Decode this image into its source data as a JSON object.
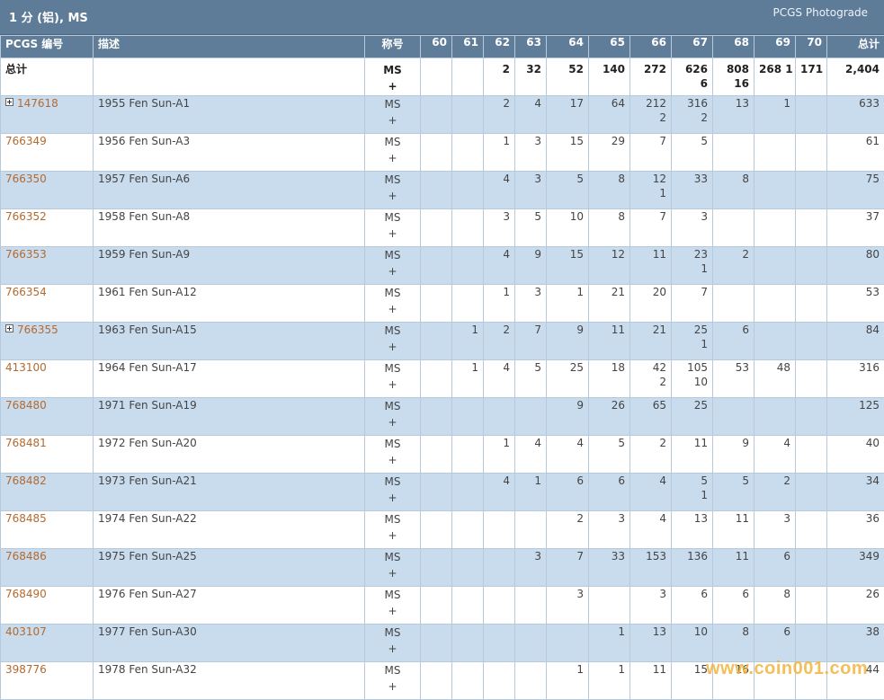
{
  "title": "1 分 (铝), MS",
  "brand": "PCGS Photograde",
  "headers": [
    "PCGS 编号",
    "描述",
    "称号",
    "60",
    "61",
    "62",
    "63",
    "64",
    "65",
    "66",
    "67",
    "68",
    "69",
    "70",
    "总计"
  ],
  "total": {
    "label": "总计",
    "designation": [
      "MS",
      "+"
    ],
    "grades": [
      "",
      "",
      "2",
      "32",
      "52",
      "140",
      "272",
      "626\n6",
      "808\n16",
      "268\n1",
      "171",
      ""
    ],
    "sum": "2,404"
  },
  "rows": [
    {
      "pcgs": "147618",
      "expand": true,
      "desc": "1955 Fen Sun-A1",
      "designation": [
        "MS",
        "+"
      ],
      "grades": [
        "",
        "",
        "2",
        "4",
        "17",
        "64",
        "212\n2",
        "316\n2",
        "13",
        "1",
        "",
        ""
      ],
      "total": "633"
    },
    {
      "pcgs": "766349",
      "expand": false,
      "desc": "1956 Fen Sun-A3",
      "designation": [
        "MS",
        "+"
      ],
      "grades": [
        "",
        "",
        "1",
        "3",
        "15",
        "29",
        "7",
        "5",
        "",
        "",
        "",
        ""
      ],
      "total": "61"
    },
    {
      "pcgs": "766350",
      "expand": false,
      "desc": "1957 Fen Sun-A6",
      "designation": [
        "MS",
        "+"
      ],
      "grades": [
        "",
        "",
        "4",
        "3",
        "5",
        "8",
        "12\n1",
        "33",
        "8",
        "",
        "",
        ""
      ],
      "total": "75"
    },
    {
      "pcgs": "766352",
      "expand": false,
      "desc": "1958 Fen Sun-A8",
      "designation": [
        "MS",
        "+"
      ],
      "grades": [
        "",
        "",
        "3",
        "5",
        "10",
        "8",
        "7",
        "3",
        "",
        "",
        "",
        ""
      ],
      "total": "37"
    },
    {
      "pcgs": "766353",
      "expand": false,
      "desc": "1959 Fen Sun-A9",
      "designation": [
        "MS",
        "+"
      ],
      "grades": [
        "",
        "",
        "4",
        "9",
        "15",
        "12",
        "11",
        "23\n1",
        "2",
        "",
        "",
        ""
      ],
      "total": "80"
    },
    {
      "pcgs": "766354",
      "expand": false,
      "desc": "1961 Fen Sun-A12",
      "designation": [
        "MS",
        "+"
      ],
      "grades": [
        "",
        "",
        "1",
        "3",
        "1",
        "21",
        "20",
        "7",
        "",
        "",
        "",
        ""
      ],
      "total": "53"
    },
    {
      "pcgs": "766355",
      "expand": true,
      "desc": "1963 Fen Sun-A15",
      "designation": [
        "MS",
        "+"
      ],
      "grades": [
        "",
        "1",
        "2",
        "7",
        "9",
        "11",
        "21",
        "25\n1",
        "6",
        "",
        "",
        ""
      ],
      "total": "84"
    },
    {
      "pcgs": "413100",
      "expand": false,
      "desc": "1964 Fen Sun-A17",
      "designation": [
        "MS",
        "+"
      ],
      "grades": [
        "",
        "1",
        "4",
        "5",
        "25",
        "18",
        "42\n2",
        "105\n10",
        "53",
        "48",
        "",
        ""
      ],
      "total": "316"
    },
    {
      "pcgs": "768480",
      "expand": false,
      "desc": "1971 Fen Sun-A19",
      "designation": [
        "MS",
        "+"
      ],
      "grades": [
        "",
        "",
        "",
        "",
        "9",
        "26",
        "65",
        "25",
        "",
        "",
        "",
        ""
      ],
      "total": "125"
    },
    {
      "pcgs": "768481",
      "expand": false,
      "desc": "1972 Fen Sun-A20",
      "designation": [
        "MS",
        "+"
      ],
      "grades": [
        "",
        "",
        "1",
        "4",
        "4",
        "5",
        "2",
        "11",
        "9",
        "4",
        "",
        ""
      ],
      "total": "40"
    },
    {
      "pcgs": "768482",
      "expand": false,
      "desc": "1973 Fen Sun-A21",
      "designation": [
        "MS",
        "+"
      ],
      "grades": [
        "",
        "",
        "4",
        "1",
        "6",
        "6",
        "4",
        "5\n1",
        "5",
        "2",
        "",
        ""
      ],
      "total": "34"
    },
    {
      "pcgs": "768485",
      "expand": false,
      "desc": "1974 Fen Sun-A22",
      "designation": [
        "MS",
        "+"
      ],
      "grades": [
        "",
        "",
        "",
        "",
        "2",
        "3",
        "4",
        "13",
        "11",
        "3",
        "",
        ""
      ],
      "total": "36"
    },
    {
      "pcgs": "768486",
      "expand": false,
      "desc": "1975 Fen Sun-A25",
      "designation": [
        "MS",
        "+"
      ],
      "grades": [
        "",
        "",
        "",
        "3",
        "7",
        "33",
        "153",
        "136",
        "11",
        "6",
        "",
        ""
      ],
      "total": "349"
    },
    {
      "pcgs": "768490",
      "expand": false,
      "desc": "1976 Fen Sun-A27",
      "designation": [
        "MS",
        "+"
      ],
      "grades": [
        "",
        "",
        "",
        "",
        "3",
        "",
        "3",
        "6",
        "6",
        "8",
        "",
        ""
      ],
      "total": "26"
    },
    {
      "pcgs": "403107",
      "expand": false,
      "desc": "1977 Fen Sun-A30",
      "designation": [
        "MS",
        "+"
      ],
      "grades": [
        "",
        "",
        "",
        "",
        "",
        "1",
        "13",
        "10",
        "8",
        "6",
        "",
        ""
      ],
      "total": "38"
    },
    {
      "pcgs": "398776",
      "expand": false,
      "desc": "1978 Fen Sun-A32",
      "designation": [
        "MS",
        "+"
      ],
      "grades": [
        "",
        "",
        "",
        "",
        "1",
        "1",
        "11",
        "15",
        "16",
        "",
        "",
        ""
      ],
      "total": "44"
    }
  ],
  "watermark": "www.coin001.com",
  "colors": {
    "header": "#5f7c98",
    "row_alt": "#c9dcee",
    "link": "#b36a30",
    "watermark": "#f1b43d"
  }
}
